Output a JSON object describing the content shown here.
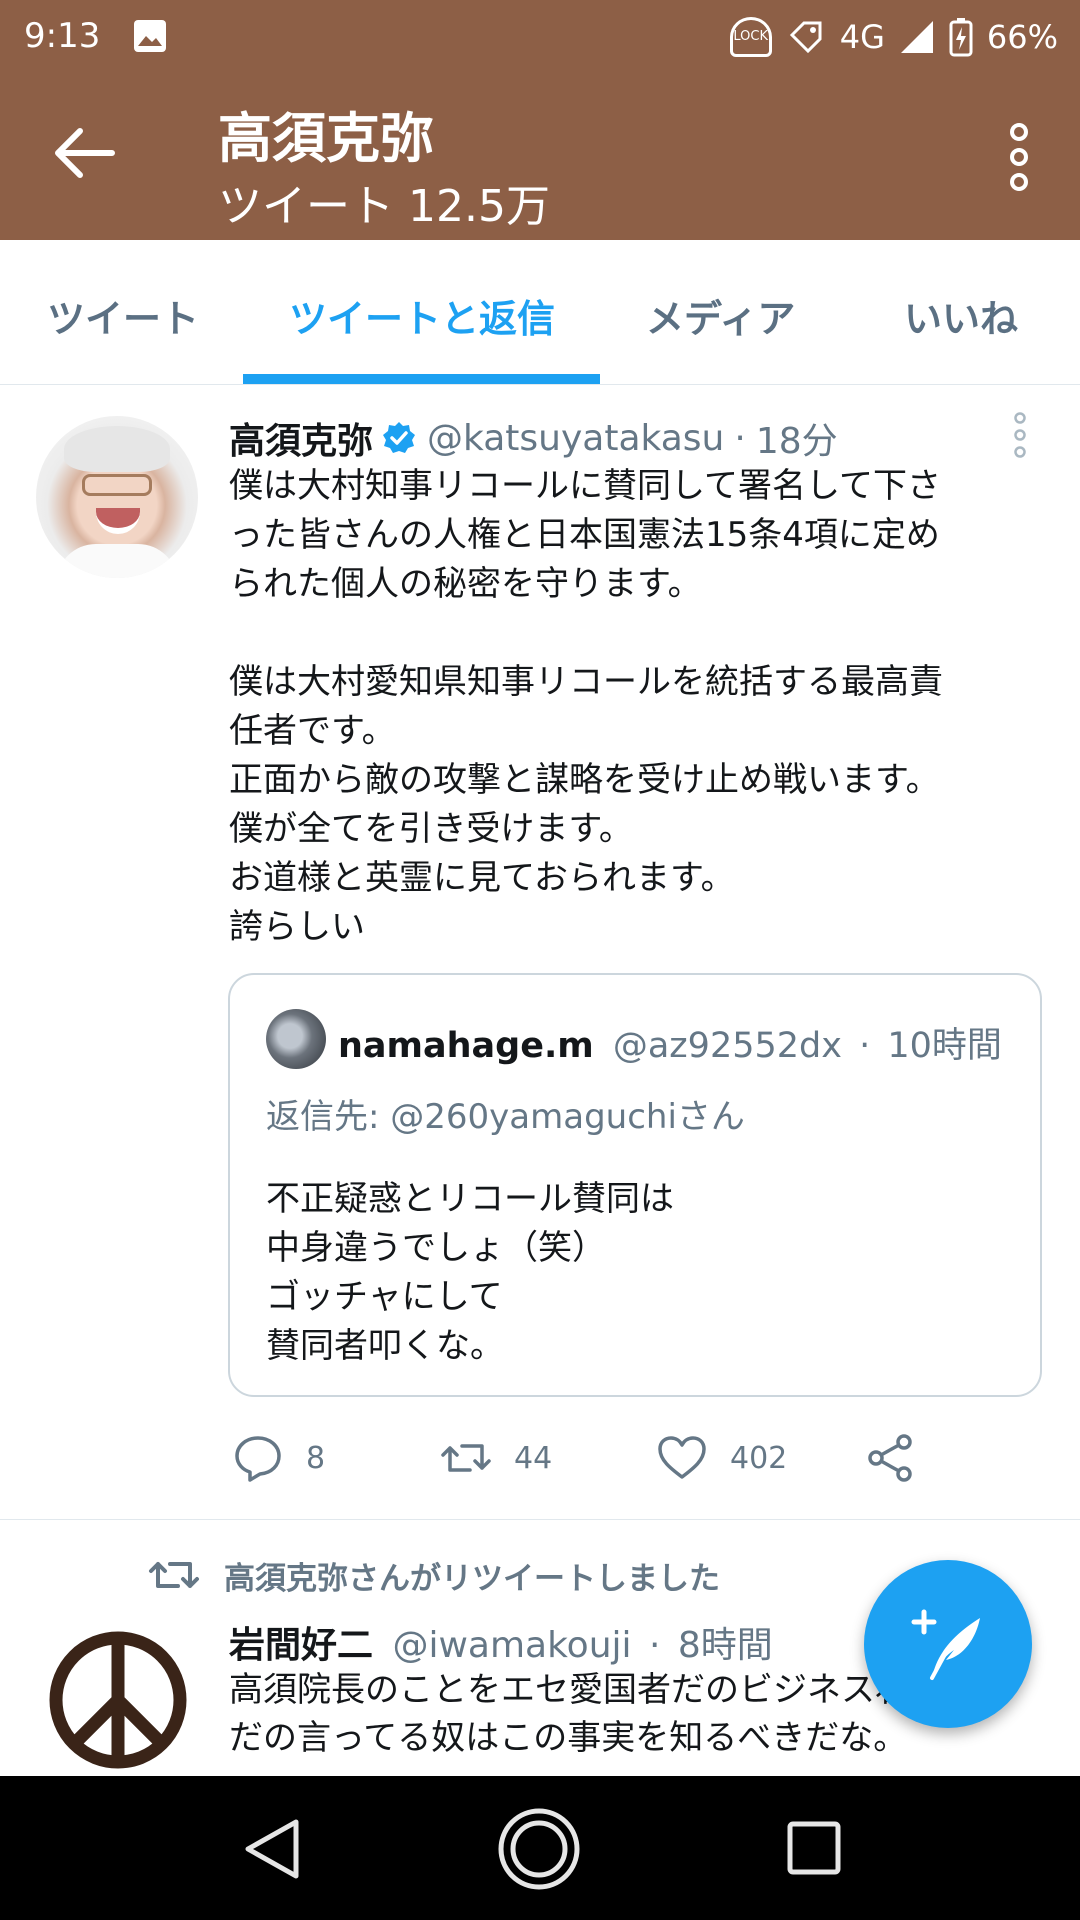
{
  "status_bar": {
    "time": "9:13",
    "lock_label": "LOCK",
    "network": "4G",
    "battery": "66%"
  },
  "header": {
    "title": "高須克弥",
    "subtitle": "ツイート 12.5万"
  },
  "tabs": [
    {
      "label": "ツイート",
      "active": false
    },
    {
      "label": "ツイートと返信",
      "active": true
    },
    {
      "label": "メディア",
      "active": false
    },
    {
      "label": "いいね",
      "active": false
    }
  ],
  "tweet1": {
    "name": "高須克弥",
    "handle": "@katsuyatakasu",
    "sep": "·",
    "time": "18分",
    "body": [
      "僕は大村知事リコールに賛同して署名して下さ",
      "った皆さんの人権と日本国憲法15条4項に定め",
      "られた個人の秘密を守ります。",
      "",
      "僕は大村愛知県知事リコールを統括する最高責",
      "任者です。",
      "正面から敵の攻撃と謀略を受け止め戦います。",
      "僕が全てを引き受けます。",
      "お道様と英霊に見ておられます。",
      "誇らしい"
    ],
    "quote": {
      "name": "namahage.m",
      "handle": "@az92552dx",
      "sep": "·",
      "time": "10時間",
      "reply_prefix": "返信先: ",
      "reply_to": "@260yamaguchiさん",
      "body": [
        "不正疑惑とリコール賛同は",
        "中身違うでしょ（笑）",
        "ゴッチャにして",
        "賛同者叩くな。"
      ]
    },
    "actions": {
      "replies": "8",
      "retweets": "44",
      "likes": "402"
    }
  },
  "tweet2": {
    "retweeted_by": "高須克弥さんがリツイートしました",
    "name": "岩間好二",
    "handle": "@iwamakouji",
    "sep": "·",
    "time": "8時間",
    "body": [
      "高須院長のことをエセ愛国者だのビジネス右翼",
      "だの言ってる奴はこの事実を知るべきだな。"
    ]
  },
  "colors": {
    "header_bg": "#8d5f46",
    "accent": "#1da1f2",
    "muted": "#657786"
  }
}
